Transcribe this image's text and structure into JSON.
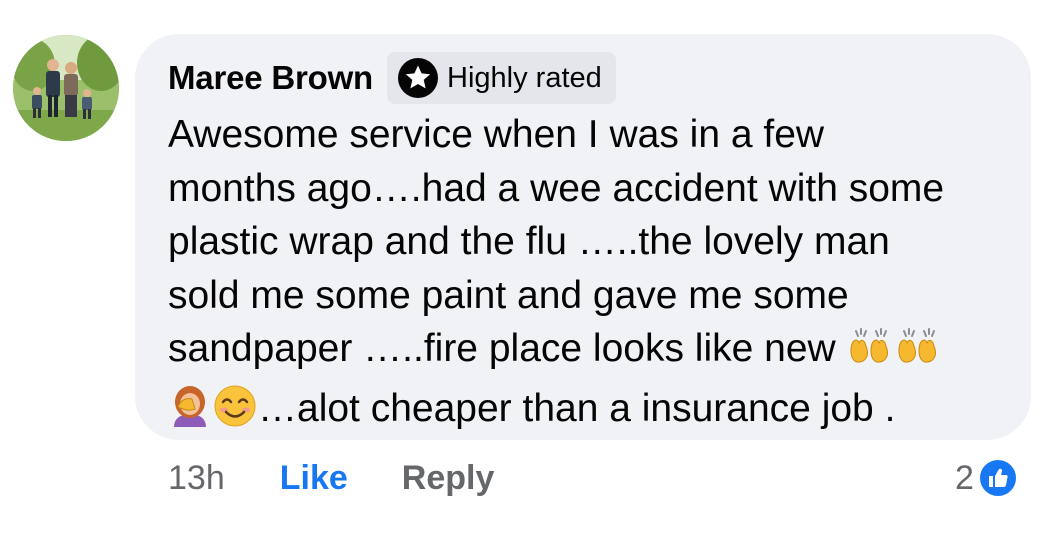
{
  "comment": {
    "author": "Maree Brown",
    "badge_label": "Highly rated",
    "text_lines": [
      "Awesome service when I was in a few",
      "months ago….had a wee accident with some",
      "plastic wrap and the flu …..the lovely man",
      "sold me some paint and gave me some",
      "sandpaper …..fire place looks like new",
      "…alot cheaper than a insurance job ."
    ],
    "emojis": {
      "line5_trailing": [
        "raising-hands",
        "raising-hands"
      ],
      "line6_leading": [
        "person-facepalming",
        "smiling-face-with-smiling-eyes"
      ]
    },
    "timestamp": "13h",
    "like_label": "Like",
    "reply_label": "Reply",
    "reaction_count": "2",
    "reaction_icon": "thumbs-up-icon"
  },
  "colors": {
    "bubble": "#f0f2f5",
    "badge": "#e4e6eb",
    "like_blue": "#1877f2",
    "secondary_text": "#65676b"
  }
}
